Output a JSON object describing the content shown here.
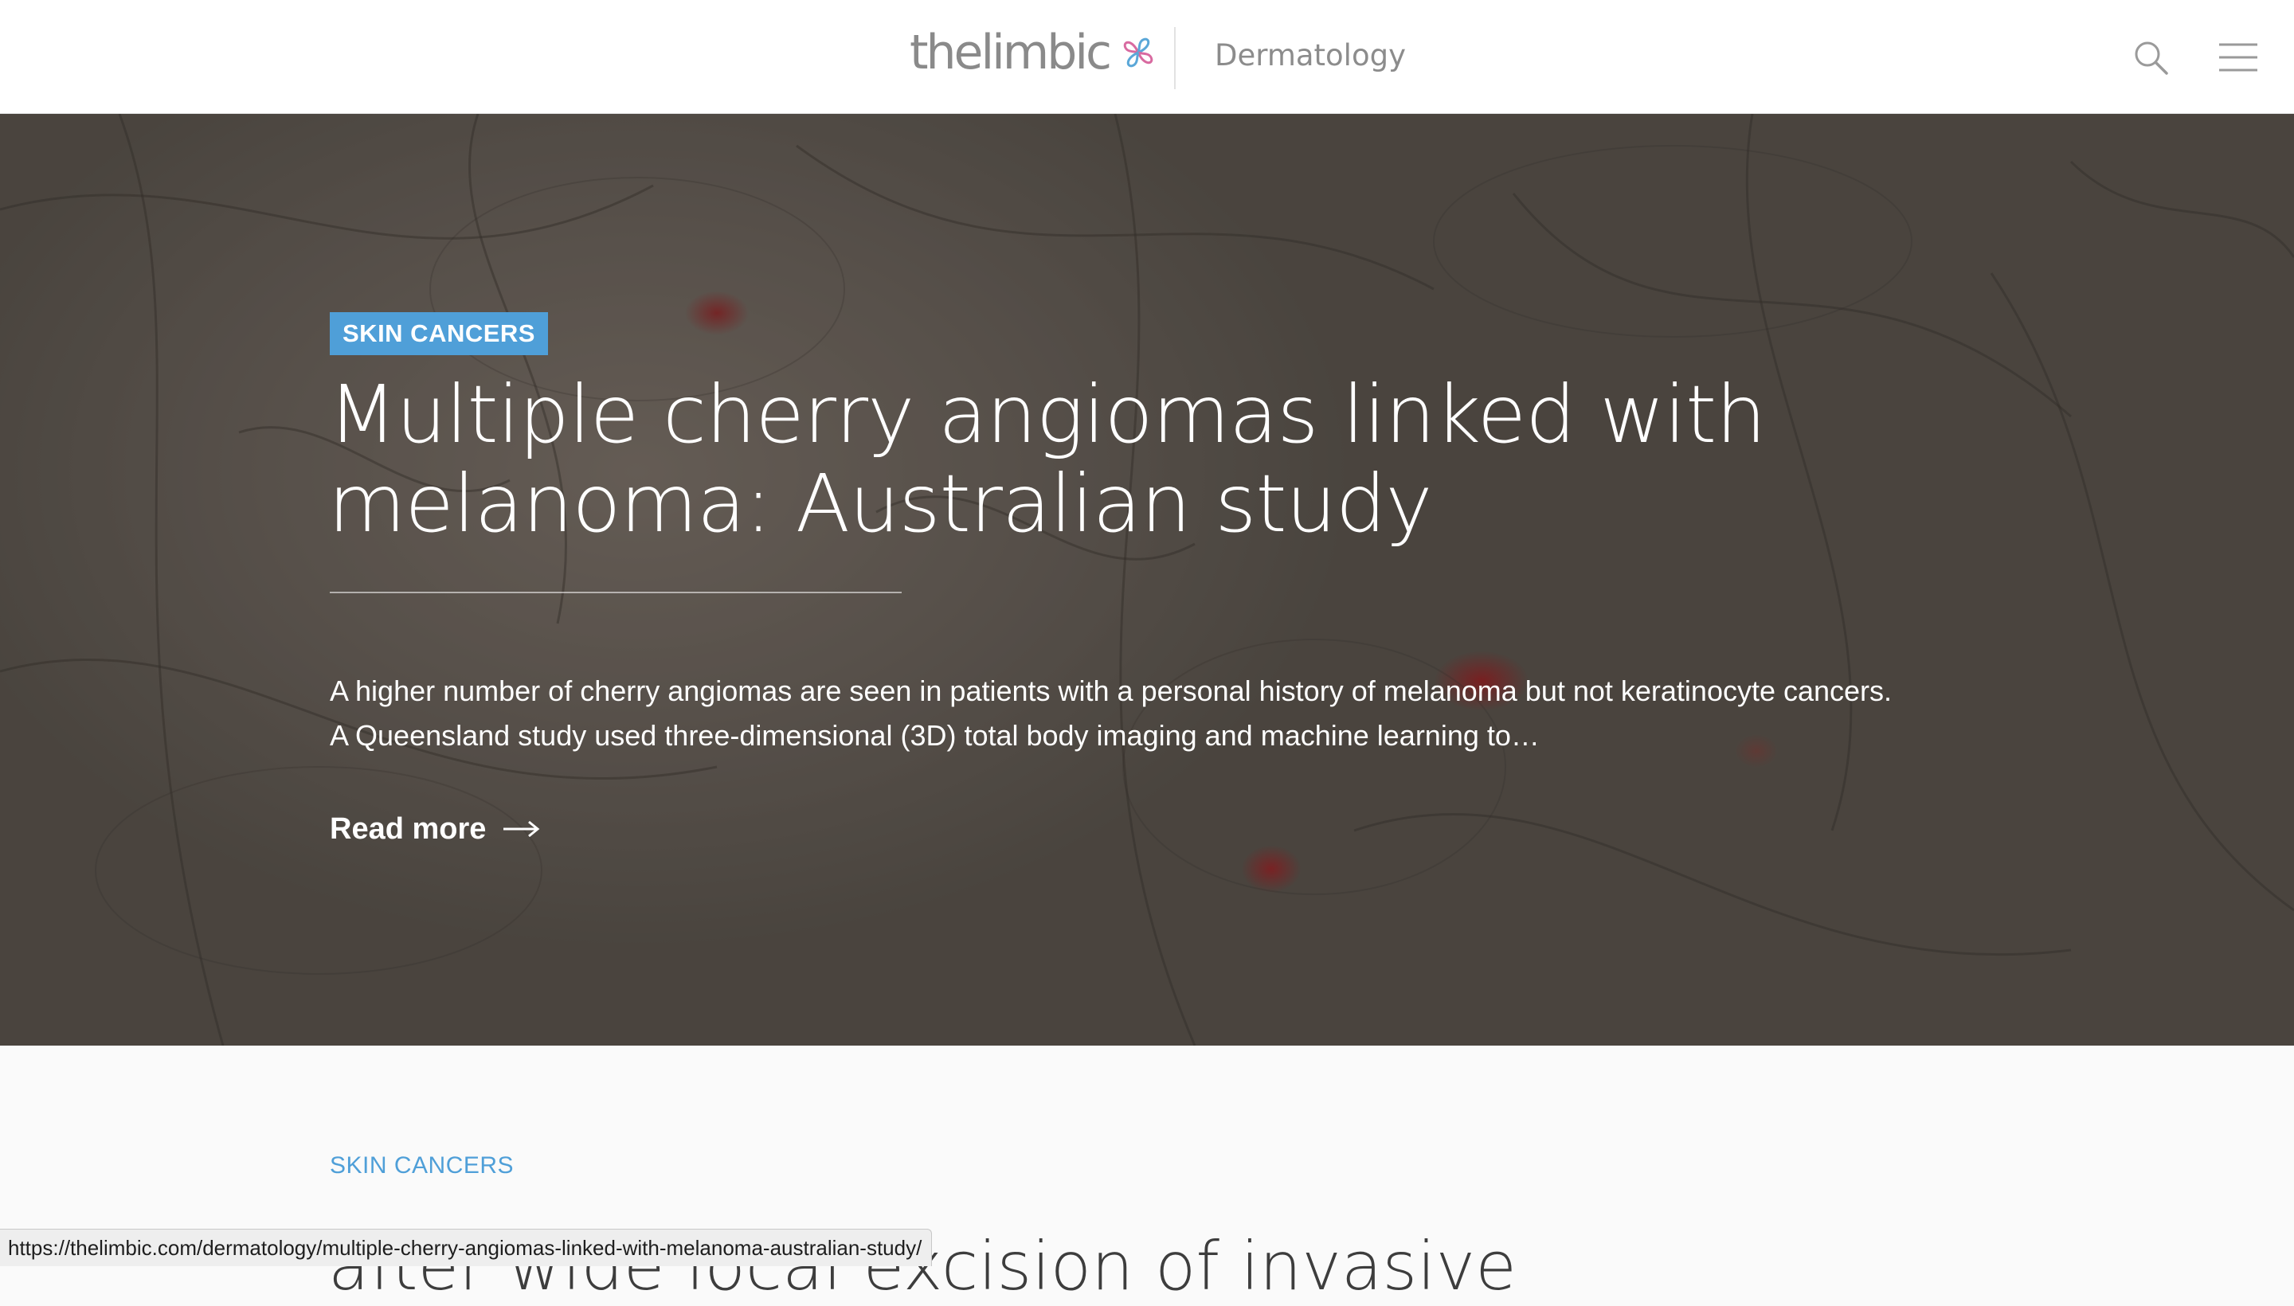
{
  "header": {
    "logo": {
      "text": "thelimbic",
      "icon": "limbic-logo-mark"
    },
    "section_name": "Dermatology",
    "icons": {
      "search": "search-icon",
      "menu": "hamburger-menu-icon"
    }
  },
  "hero": {
    "category": "SKIN CANCERS",
    "title": "Multiple cherry angiomas linked with melanoma: Australian study",
    "excerpt": "A higher number of cherry angiomas are seen in patients with a personal history of melanoma but not keratinocyte cancers. A Queensland study used three-dimensional (3D) total body imaging and machine learning to…",
    "read_more": "Read more",
    "read_more_icon": "arrow-right-icon"
  },
  "next_article": {
    "category": "SKIN CANCERS",
    "title_partial": "after wide local excision of invasive"
  },
  "status_bar": {
    "url": "https://thelimbic.com/dermatology/multiple-cherry-angiomas-linked-with-melanoma-australian-study/"
  },
  "colors": {
    "accent": "#4f9fd8",
    "header_bg": "#ffffff",
    "page_bg": "#fafafa",
    "logo_pink": "#d86aa0",
    "logo_blue": "#5aa7d8"
  }
}
